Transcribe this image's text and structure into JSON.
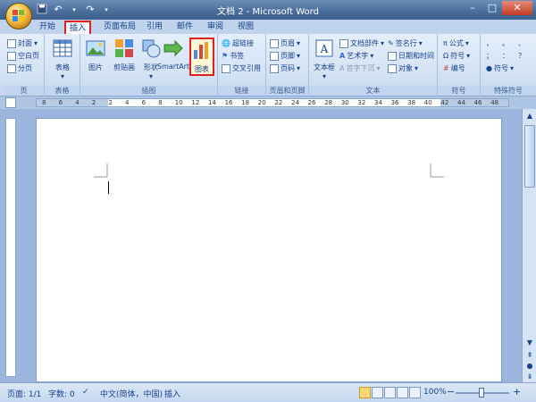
{
  "window": {
    "title": "文档 2 - Microsoft Word"
  },
  "quick_access": {
    "save_icon": "save-icon",
    "undo_icon": "undo-icon",
    "redo_icon": "redo-icon",
    "customize_icon": "chevron-down-icon"
  },
  "tabs": [
    {
      "label": "开始"
    },
    {
      "label": "插入"
    },
    {
      "label": "页面布局"
    },
    {
      "label": "引用"
    },
    {
      "label": "邮件"
    },
    {
      "label": "审阅"
    },
    {
      "label": "视图"
    }
  ],
  "ribbon": {
    "pages": {
      "label": "页",
      "items": [
        "封面",
        "空白页",
        "分页"
      ]
    },
    "tables": {
      "label": "表格",
      "button": "表格"
    },
    "illustrations": {
      "label": "插图",
      "buttons": [
        "图片",
        "剪贴画",
        "形状",
        "SmartArt",
        "图表"
      ]
    },
    "links": {
      "label": "链接",
      "items": [
        "超链接",
        "书签",
        "交叉引用"
      ]
    },
    "header_footer": {
      "label": "页眉和页脚",
      "items": [
        "页眉",
        "页脚",
        "页码"
      ]
    },
    "text": {
      "label": "文本",
      "big": "文本框",
      "items": [
        "文档部件",
        "艺术字",
        "首字下沉",
        "签名行",
        "日期和时间",
        "对象"
      ]
    },
    "symbols": {
      "label": "符号",
      "items": [
        "公式",
        "符号",
        "编号"
      ]
    },
    "special_symbols": {
      "label": "特殊符号",
      "items": [
        "，",
        "。",
        "、",
        "；",
        "：",
        "？",
        "符号"
      ]
    }
  },
  "ruler": {
    "numbers": [
      "8",
      "6",
      "4",
      "2",
      "2",
      "4",
      "6",
      "8",
      "10",
      "12",
      "14",
      "16",
      "18",
      "20",
      "22",
      "24",
      "26",
      "28",
      "30",
      "32",
      "34",
      "36",
      "38",
      "40",
      "42",
      "44",
      "46",
      "48"
    ]
  },
  "status": {
    "page": "页面: 1/1",
    "words": "字数: 0",
    "language": "中文(简体，中国)",
    "mode": "插入",
    "zoom": "100%",
    "zoom_out": "−",
    "zoom_in": "+"
  }
}
